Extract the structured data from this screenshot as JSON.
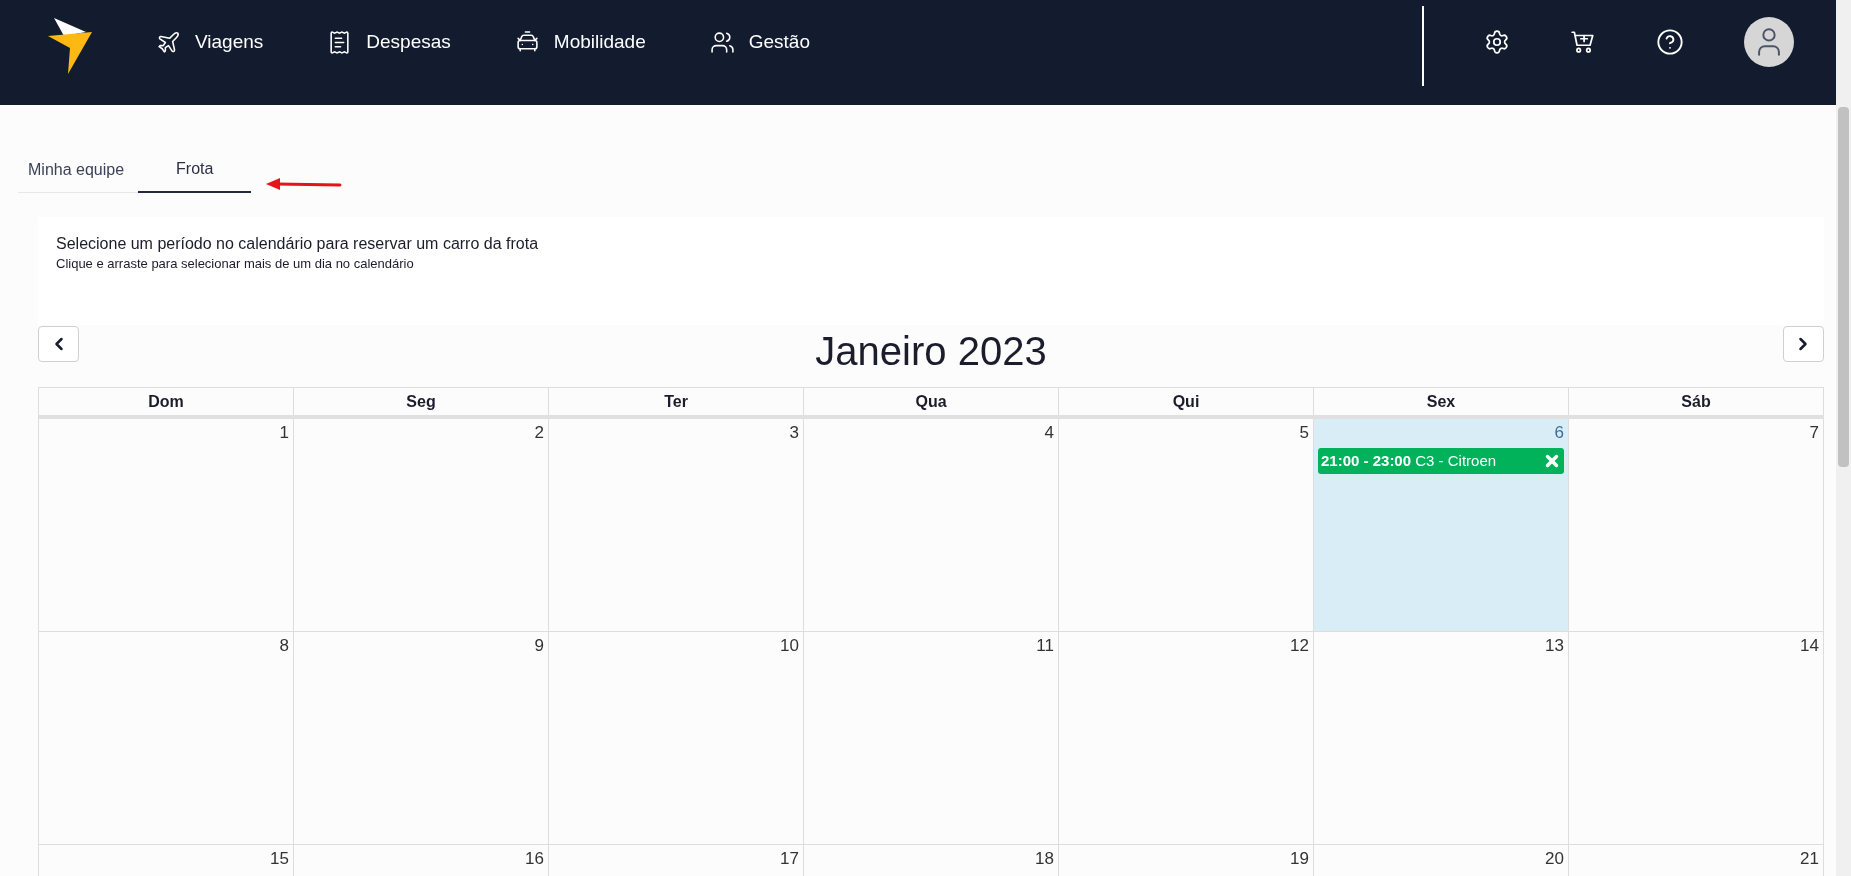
{
  "nav": {
    "items": [
      {
        "kind": "plane",
        "label": "Viagens"
      },
      {
        "kind": "receipt",
        "label": "Despesas"
      },
      {
        "kind": "car",
        "label": "Mobilidade"
      },
      {
        "kind": "users",
        "label": "Gestão"
      }
    ]
  },
  "tabs": [
    {
      "label": "Minha equipe",
      "selected": false
    },
    {
      "label": "Frota",
      "selected": true
    }
  ],
  "info": {
    "title": "Selecione um período no calendário para reservar um carro da frota",
    "hint": "Clique e arraste para selecionar mais de um dia no calendário"
  },
  "calendar": {
    "title": "Janeiro 2023",
    "weekdays": [
      "Dom",
      "Seg",
      "Ter",
      "Qua",
      "Qui",
      "Sex",
      "Sáb"
    ],
    "weeks": [
      [
        {
          "day": "1",
          "selected": false
        },
        {
          "day": "2",
          "selected": false
        },
        {
          "day": "3",
          "selected": false
        },
        {
          "day": "4",
          "selected": false
        },
        {
          "day": "5",
          "selected": false
        },
        {
          "day": "6",
          "selected": true,
          "events": [
            {
              "time": "21:00 - 23:00",
              "title": "C3 - Citroen"
            }
          ]
        },
        {
          "day": "7",
          "selected": false
        }
      ],
      [
        {
          "day": "8",
          "selected": false
        },
        {
          "day": "9",
          "selected": false
        },
        {
          "day": "10",
          "selected": false
        },
        {
          "day": "11",
          "selected": false
        },
        {
          "day": "12",
          "selected": false
        },
        {
          "day": "13",
          "selected": false
        },
        {
          "day": "14",
          "selected": false
        }
      ],
      [
        {
          "day": "15",
          "selected": false
        },
        {
          "day": "16",
          "selected": false
        },
        {
          "day": "17",
          "selected": false
        },
        {
          "day": "18",
          "selected": false
        },
        {
          "day": "19",
          "selected": false
        },
        {
          "day": "20",
          "selected": false
        },
        {
          "day": "21",
          "selected": false
        }
      ]
    ]
  }
}
